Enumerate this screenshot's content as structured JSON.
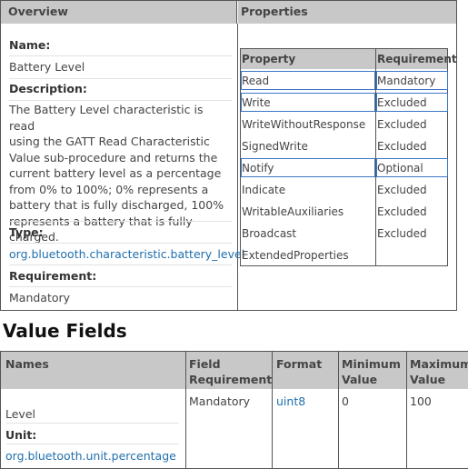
{
  "overview": {
    "header": "Overview",
    "name_label": "Name:",
    "name_value": "Battery Level",
    "description_label": "Description:",
    "description_lines": [
      "The Battery Level characteristic is read",
      "using the GATT Read Characteristic",
      "Value sub-procedure and returns the",
      "current battery level as a percentage",
      "from 0% to 100%; 0% represents a",
      "battery that is fully discharged, 100%",
      "represents a battery that is fully charged."
    ],
    "type_label": "Type:",
    "type_value": "org.bluetooth.characteristic.battery_level",
    "requirement_label": "Requirement:",
    "requirement_value": "Mandatory"
  },
  "properties": {
    "header": "Properties",
    "col_property": "Property",
    "col_requirement": "Requirement",
    "rows": [
      {
        "property": "Read",
        "requirement": "Mandatory"
      },
      {
        "property": "Write",
        "requirement": "Excluded"
      },
      {
        "property": "WriteWithoutResponse",
        "requirement": "Excluded"
      },
      {
        "property": "SignedWrite",
        "requirement": "Excluded"
      },
      {
        "property": "Notify",
        "requirement": "Optional"
      },
      {
        "property": "Indicate",
        "requirement": "Excluded"
      },
      {
        "property": "WritableAuxiliaries",
        "requirement": "Excluded"
      },
      {
        "property": "Broadcast",
        "requirement": "Excluded"
      },
      {
        "property": "ExtendedProperties",
        "requirement": ""
      }
    ]
  },
  "value_fields": {
    "title": "Value Fields",
    "headers": {
      "names": "Names",
      "field_requirement_1": "Field",
      "field_requirement_2": "Requirement",
      "format": "Format",
      "minimum_1": "Minimum",
      "minimum_2": "Value",
      "maximum_1": "Maximum",
      "maximum_2": "Value"
    },
    "row": {
      "name": "Level",
      "unit_label": "Unit:",
      "unit_value": "org.bluetooth.unit.percentage",
      "requirement": "Mandatory",
      "format": "uint8",
      "minimum": "0",
      "maximum": "100"
    }
  },
  "colors": {
    "header_bg": "#c8c8c8",
    "link": "#1f6fae",
    "highlight_border": "#3a76c4"
  }
}
